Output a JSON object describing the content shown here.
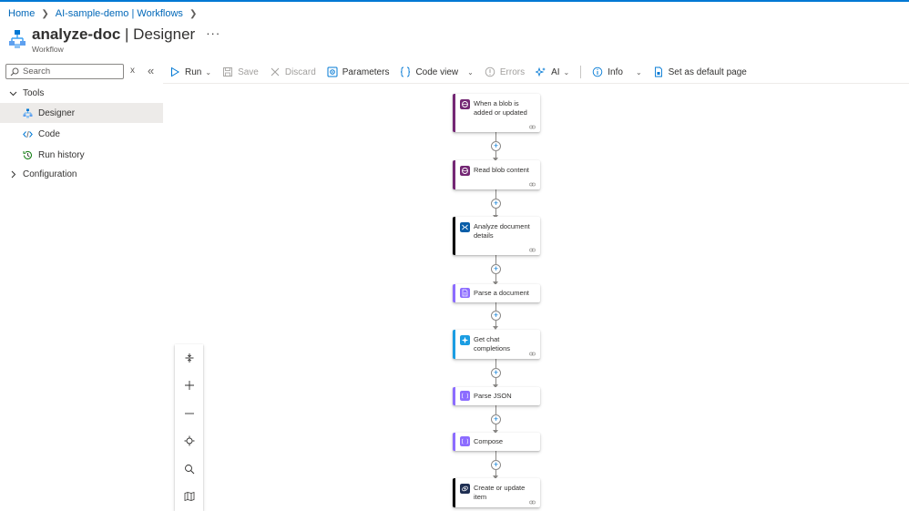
{
  "breadcrumb": [
    "Home",
    "AI-sample-demo | Workflows"
  ],
  "header": {
    "title_bold": "analyze-doc",
    "title_rest": " | Designer",
    "subtitle": "Workflow",
    "more": "···"
  },
  "search": {
    "placeholder": "Search",
    "clear": "x",
    "collapse": "«"
  },
  "sidebar": {
    "tools_label": "Tools",
    "items": [
      {
        "label": "Designer",
        "icon": "designer-icon",
        "active": true
      },
      {
        "label": "Code",
        "icon": "code-icon"
      },
      {
        "label": "Run history",
        "icon": "history-icon"
      }
    ],
    "configuration_label": "Configuration"
  },
  "toolbar": {
    "run": "Run",
    "save": "Save",
    "discard": "Discard",
    "parameters": "Parameters",
    "code_view": "Code view",
    "errors": "Errors",
    "ai": "AI",
    "info": "Info",
    "set_default": "Set as default page"
  },
  "workflow": {
    "steps": [
      {
        "label": "When a blob is added or updated",
        "color": "#742774",
        "icon": "blob-trigger-icon",
        "linked": true
      },
      {
        "label": "Read blob content",
        "color": "#742774",
        "icon": "blob-icon",
        "linked": true
      },
      {
        "label": "Analyze document details",
        "color": "#000000",
        "icon": "document-intelligence-icon",
        "linked": true
      },
      {
        "label": "Parse a document",
        "color": "#8c6cff",
        "icon": "parse-document-icon",
        "linked": false
      },
      {
        "label": "Get chat completions",
        "color": "#1b9de2",
        "icon": "openai-icon",
        "linked": true
      },
      {
        "label": "Parse JSON",
        "color": "#8c6cff",
        "icon": "data-operations-icon",
        "linked": false
      },
      {
        "label": "Compose",
        "color": "#8c6cff",
        "icon": "data-operations-icon",
        "linked": false
      },
      {
        "label": "Create or update item",
        "color": "#000000",
        "icon": "cosmos-db-icon",
        "linked": true
      }
    ]
  },
  "colors": {
    "accent": "#0078d4",
    "link": "#0067b8",
    "logic_purple": "#742774",
    "data_ops": "#8c6cff"
  }
}
